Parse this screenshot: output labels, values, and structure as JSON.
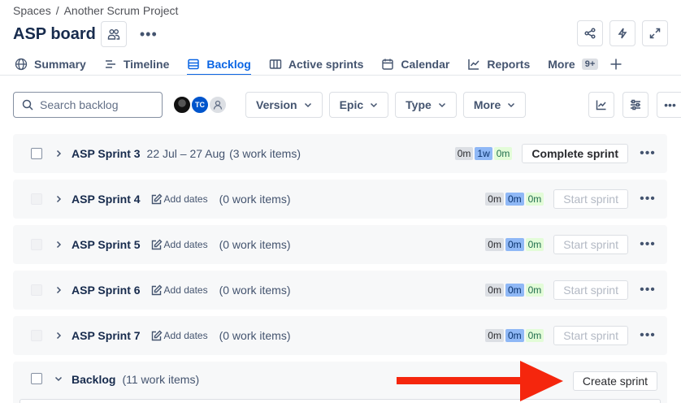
{
  "breadcrumb": {
    "spaces": "Spaces",
    "separator": "/",
    "project": "Another Scrum Project"
  },
  "board": {
    "title": "ASP board"
  },
  "tabs": [
    {
      "label": "Summary",
      "icon": "globe-icon"
    },
    {
      "label": "Timeline",
      "icon": "timeline-icon"
    },
    {
      "label": "Backlog",
      "icon": "backlog-icon",
      "active": true
    },
    {
      "label": "Active sprints",
      "icon": "columns-icon"
    },
    {
      "label": "Calendar",
      "icon": "calendar-icon"
    },
    {
      "label": "Reports",
      "icon": "chart-icon"
    },
    {
      "label": "More",
      "icon": "none",
      "badge": "9+"
    }
  ],
  "filters": {
    "search_placeholder": "Search backlog",
    "avatar_initials": "TC",
    "version": "Version",
    "epic": "Epic",
    "type": "Type",
    "more": "More"
  },
  "sprints": [
    {
      "name": "ASP Sprint 3",
      "dates": "22 Jul – 27 Aug",
      "count": "(3 work items)",
      "todo": "0m",
      "progress": "1w",
      "done": "0m",
      "action": "Complete sprint"
    },
    {
      "name": "ASP Sprint 4",
      "add_dates": "Add dates",
      "count": "(0 work items)",
      "todo": "0m",
      "progress": "0m",
      "done": "0m",
      "action": "Start sprint"
    },
    {
      "name": "ASP Sprint 5",
      "add_dates": "Add dates",
      "count": "(0 work items)",
      "todo": "0m",
      "progress": "0m",
      "done": "0m",
      "action": "Start sprint"
    },
    {
      "name": "ASP Sprint 6",
      "add_dates": "Add dates",
      "count": "(0 work items)",
      "todo": "0m",
      "progress": "0m",
      "done": "0m",
      "action": "Start sprint"
    },
    {
      "name": "ASP Sprint 7",
      "add_dates": "Add dates",
      "count": "(0 work items)",
      "todo": "0m",
      "progress": "0m",
      "done": "0m",
      "action": "Start sprint"
    }
  ],
  "backlog": {
    "name": "Backlog",
    "count": "(11 work items)",
    "action": "Create sprint"
  },
  "colors": {
    "accent": "#0c66e4",
    "annotation_arrow": "#f5260d"
  }
}
